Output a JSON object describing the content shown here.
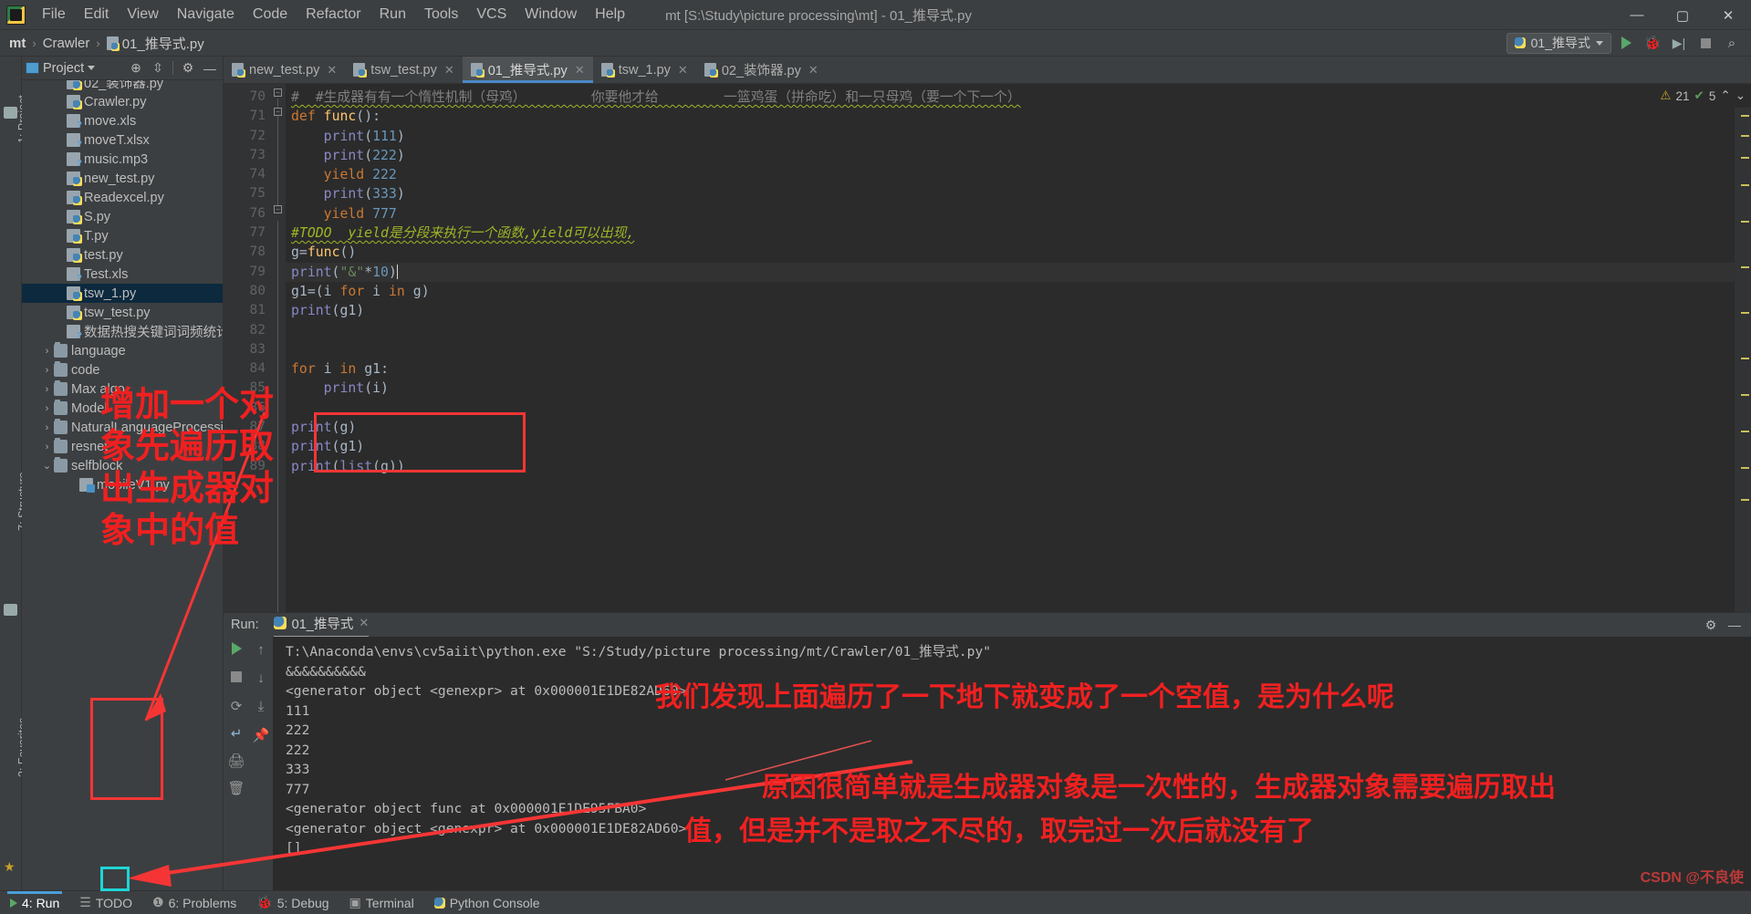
{
  "window": {
    "title": "mt [S:\\Study\\picture processing\\mt] - 01_推导式.py",
    "app_icon": "pycharm-icon",
    "minimize": "—",
    "maximize": "▢",
    "close": "✕"
  },
  "menu": [
    {
      "label": "File"
    },
    {
      "label": "Edit"
    },
    {
      "label": "View"
    },
    {
      "label": "Navigate"
    },
    {
      "label": "Code"
    },
    {
      "label": "Refactor"
    },
    {
      "label": "Run"
    },
    {
      "label": "Tools"
    },
    {
      "label": "VCS"
    },
    {
      "label": "Window"
    },
    {
      "label": "Help"
    }
  ],
  "breadcrumb": {
    "items": [
      "mt",
      "Crawler",
      "01_推导式.py"
    ],
    "separator": "›"
  },
  "toolbar_right": {
    "run_config": "01_推导式",
    "run_icon": "run-triangle-icon",
    "debug_icon": "debug-bug-icon",
    "coverage_icon": "coverage-icon",
    "stop_icon": "stop-square-icon",
    "search_icon": "search-magnifier-icon"
  },
  "left_strip": {
    "project_tab": "1: Project",
    "structure_tab": "7: Structure",
    "favorites_tab": "2: Favorites"
  },
  "project_panel": {
    "title": "Project",
    "locate_icon": "crosshair-icon",
    "collapse_icon": "collapse-all-icon",
    "settings_icon": "gear-icon",
    "hide_icon": "minimize-icon",
    "tree": [
      {
        "label": "02_装饰器.py",
        "type": "py",
        "indent": 2,
        "arrow": "",
        "selected": false,
        "partial": true
      },
      {
        "label": "Crawler.py",
        "type": "py",
        "indent": 2,
        "arrow": "",
        "selected": false
      },
      {
        "label": "move.xls",
        "type": "unk",
        "indent": 2,
        "arrow": "",
        "selected": false
      },
      {
        "label": "moveT.xlsx",
        "type": "unk",
        "indent": 2,
        "arrow": "",
        "selected": false
      },
      {
        "label": "music.mp3",
        "type": "unk",
        "indent": 2,
        "arrow": "",
        "selected": false
      },
      {
        "label": "new_test.py",
        "type": "py",
        "indent": 2,
        "arrow": "",
        "selected": false
      },
      {
        "label": "Readexcel.py",
        "type": "py",
        "indent": 2,
        "arrow": "",
        "selected": false
      },
      {
        "label": "S.py",
        "type": "py",
        "indent": 2,
        "arrow": "",
        "selected": false
      },
      {
        "label": "T.py",
        "type": "py",
        "indent": 2,
        "arrow": "",
        "selected": false
      },
      {
        "label": "test.py",
        "type": "py",
        "indent": 2,
        "arrow": "",
        "selected": false
      },
      {
        "label": "Test.xls",
        "type": "unk",
        "indent": 2,
        "arrow": "",
        "selected": false
      },
      {
        "label": "tsw_1.py",
        "type": "py",
        "indent": 2,
        "arrow": "",
        "selected": true
      },
      {
        "label": "tsw_test.py",
        "type": "py",
        "indent": 2,
        "arrow": "",
        "selected": false
      },
      {
        "label": "数据热搜关键词词频统计.c",
        "type": "unk",
        "indent": 2,
        "arrow": "",
        "selected": false
      },
      {
        "label": "language",
        "type": "fold",
        "indent": 1,
        "arrow": "›",
        "selected": false
      },
      {
        "label": "code",
        "type": "fold",
        "indent": 1,
        "arrow": "›",
        "selected": false
      },
      {
        "label": "Max algo",
        "type": "fold",
        "indent": 1,
        "arrow": "›",
        "selected": false
      },
      {
        "label": "Model",
        "type": "fold",
        "indent": 1,
        "arrow": "›",
        "selected": false
      },
      {
        "label": "NaturalLanguageProcessiong",
        "type": "fold",
        "indent": 1,
        "arrow": "›",
        "selected": false
      },
      {
        "label": "resnet",
        "type": "fold",
        "indent": 1,
        "arrow": "›",
        "selected": false
      },
      {
        "label": "selfblock",
        "type": "fold",
        "indent": 1,
        "arrow": "⌄",
        "selected": false
      },
      {
        "label": "mobileV1.py",
        "type": "mod",
        "indent": 3,
        "arrow": "",
        "selected": false
      }
    ]
  },
  "editor_tabs": [
    {
      "label": "new_test.py",
      "active": false,
      "close": "✕"
    },
    {
      "label": "tsw_test.py",
      "active": false,
      "close": "✕"
    },
    {
      "label": "01_推导式.py",
      "active": true,
      "close": "✕"
    },
    {
      "label": "tsw_1.py",
      "active": false,
      "close": "✕"
    },
    {
      "label": "02_装饰器.py",
      "active": false,
      "close": "✕"
    }
  ],
  "inspection": {
    "warnings_icon": "warning-triangle-icon",
    "warnings": "21",
    "checks_icon": "check-icon",
    "checks": "5",
    "chevron_up": "⌃",
    "chevron_down": "⌄"
  },
  "code": {
    "first_line_number": 70,
    "lines": [
      {
        "n": 70,
        "text": "#  #生成器有有一个惰性机制（母鸡）        你要他才给        一篮鸡蛋（拼命吃）和一只母鸡（要一个下一个）"
      },
      {
        "n": 71,
        "text": "def func():"
      },
      {
        "n": 72,
        "text": "    print(111)"
      },
      {
        "n": 73,
        "text": "    print(222)"
      },
      {
        "n": 74,
        "text": "    yield 222"
      },
      {
        "n": 75,
        "text": "    print(333)"
      },
      {
        "n": 76,
        "text": "    yield 777"
      },
      {
        "n": 77,
        "text": "#TODO  yield是分段来执行一个函数,yield可以出现,"
      },
      {
        "n": 78,
        "text": "g=func()"
      },
      {
        "n": 79,
        "text": "print(\"&\"*10)"
      },
      {
        "n": 80,
        "text": "g1=(i for i in g)"
      },
      {
        "n": 81,
        "text": "print(g1)"
      },
      {
        "n": 82,
        "text": ""
      },
      {
        "n": 83,
        "text": ""
      },
      {
        "n": 84,
        "text": "for i in g1:"
      },
      {
        "n": 85,
        "text": "    print(i)"
      },
      {
        "n": 86,
        "text": ""
      },
      {
        "n": 87,
        "text": "print(g)"
      },
      {
        "n": 88,
        "text": "print(g1)"
      },
      {
        "n": 89,
        "text": "print(list(g))"
      }
    ],
    "current_line": 79
  },
  "run_panel": {
    "label": "Run:",
    "tab_name": "01_推导式",
    "tab_close": "✕",
    "settings_icon": "gear-icon",
    "hide_icon": "minimize-icon",
    "toolbar_icons": [
      "rerun-play-icon",
      "stop-square-icon",
      "up-arrow-icon",
      "down-arrow-icon",
      "scroll-to-end-icon",
      "soft-wrap-icon",
      "print-icon",
      "trash-icon",
      "pin-icon"
    ],
    "console_lines": [
      "T:\\Anaconda\\envs\\cv5aiit\\python.exe \"S:/Study/picture processing/mt/Crawler/01_推导式.py\"",
      "&&&&&&&&&&",
      "<generator object <genexpr> at 0x000001E1DE82AD60>",
      "111",
      "222",
      "222",
      "333",
      "777",
      "<generator object func at 0x000001E1DE95FBA0>",
      "<generator object <genexpr> at 0x000001E1DE82AD60>",
      "[]"
    ]
  },
  "status_bar": {
    "items": [
      {
        "label": "4: Run",
        "icon": "run-triangle-icon",
        "active": true
      },
      {
        "label": "TODO",
        "icon": "list-icon",
        "active": false
      },
      {
        "label": "6: Problems",
        "icon": "error-circle-icon",
        "active": false
      },
      {
        "label": "5: Debug",
        "icon": "bug-icon",
        "active": false
      },
      {
        "label": "Terminal",
        "icon": "terminal-icon",
        "active": false
      },
      {
        "label": "Python Console",
        "icon": "python-icon",
        "active": false
      }
    ]
  },
  "annotations": {
    "sidebar_text_lines": [
      "增加一个对",
      "象先遍历取",
      "出生成器对",
      "象中的值"
    ],
    "note_1": "我们发现上面遍历了一下地下就变成了一个空值，是为什么呢",
    "note_2_line1": "原因很简单就是生成器对象是一次性的，生成器对象需要遍历取出",
    "note_2_line2": "值，但是并不是取之不尽的，取完过一次后就没有了",
    "watermark": "CSDN @不良使",
    "color_red": "#f02020",
    "color_cyan": "#1fd6d6"
  }
}
